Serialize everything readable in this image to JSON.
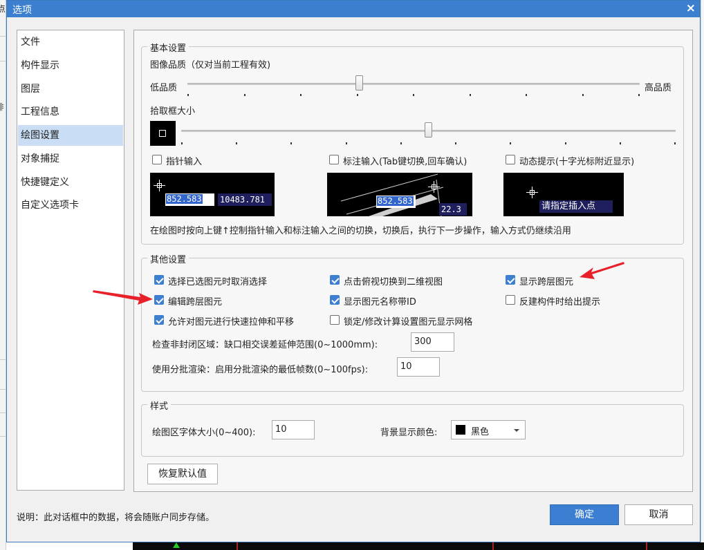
{
  "window": {
    "title": "选项",
    "close_glyph": "×"
  },
  "background": {
    "left_edge_text_1": "点",
    "left_edge_text_2": "俳"
  },
  "nav": {
    "items": [
      {
        "label": "文件",
        "selected": false
      },
      {
        "label": "构件显示",
        "selected": false
      },
      {
        "label": "图层",
        "selected": false
      },
      {
        "label": "工程信息",
        "selected": false
      },
      {
        "label": "绘图设置",
        "selected": true
      },
      {
        "label": "对象捕捉",
        "selected": false
      },
      {
        "label": "快捷键定义",
        "selected": false
      },
      {
        "label": "自定义选项卡",
        "selected": false
      }
    ]
  },
  "basic": {
    "legend": "基本设置",
    "image_quality_label": "图像品质（仅对当前工程有效)",
    "low_label": "低品质",
    "high_label": "高品质",
    "image_quality_level": 0.38,
    "pickbox_label": "拾取框大小",
    "pickbox_level": 0.5,
    "checkbox_pointer": {
      "label": "指针输入",
      "checked": false
    },
    "checkbox_dimension": {
      "label": "标注输入(Tab键切换,回车确认)",
      "checked": false
    },
    "checkbox_dynamic": {
      "label": "动态提示(十字光标附近显示)",
      "checked": false
    },
    "preview_pointer": {
      "value_a": "852.583",
      "value_b": "10483.781"
    },
    "preview_dimension": {
      "value_a": "852.583",
      "value_b": "22.3"
    },
    "preview_dynamic": {
      "prompt": "请指定插入点"
    },
    "note": "在绘图时按向上键↑控制指针输入和标注输入之间的切换，切换后，执行下一步操作，输入方式仍继续沿用"
  },
  "other": {
    "legend": "其他设置",
    "checkboxes": [
      {
        "label": "选择已选图元时取消选择",
        "checked": true
      },
      {
        "label": "点击俯视切换到二维视图",
        "checked": true
      },
      {
        "label": "显示跨层图元",
        "checked": true
      },
      {
        "label": "编辑跨层图元",
        "checked": true
      },
      {
        "label": "显示图元名称带ID",
        "checked": true
      },
      {
        "label": "反建构件时给出提示",
        "checked": false
      },
      {
        "label": "允许对图元进行快速拉伸和平移",
        "checked": true
      },
      {
        "label": "锁定/修改计算设置图元显示网格",
        "checked": false
      }
    ],
    "gap_label": "检查非封闭区域：缺口相交误差延伸范围(0~1000mm):",
    "gap_value": "300",
    "batch_label": "使用分批渲染：启用分批渲染的最低帧数(0~100fps):",
    "batch_value": "10"
  },
  "style": {
    "legend": "样式",
    "font_size_label": "绘图区字体大小(0~400):",
    "font_size_value": "10",
    "bg_color_label": "背景显示颜色:",
    "bg_color_value": "黑色",
    "bg_color_hex": "#000000"
  },
  "restore_button": "恢复默认值",
  "footer": {
    "note": "说明：此对话框中的数据，将会随账户同步存储。",
    "ok": "确定",
    "cancel": "取消"
  },
  "colors": {
    "titlebar": "#3c7fcf",
    "nav_selected": "#c9def5",
    "primary_button": "#3c7fd2",
    "checkbox_checked": "#3d7fd0",
    "annotation_arrow": "#e8202a"
  }
}
